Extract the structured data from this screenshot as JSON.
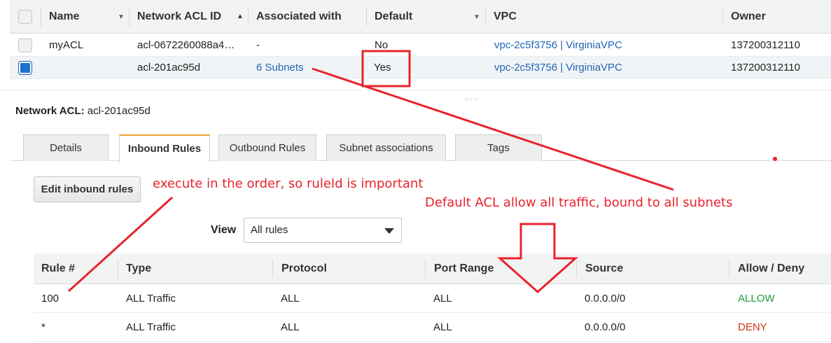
{
  "acl_table": {
    "columns": [
      "Name",
      "Network ACL ID",
      "Associated with",
      "Default",
      "VPC",
      "Owner"
    ],
    "rows": [
      {
        "name": "myACL",
        "id": "acl-0672260088a4…",
        "associated": "-",
        "default": "No",
        "vpc": "vpc-2c5f3756 | VirginiaVPC",
        "owner": "137200312110",
        "selected": false
      },
      {
        "name": "",
        "id": "acl-201ac95d",
        "associated": "6 Subnets",
        "default": "Yes",
        "vpc": "vpc-2c5f3756 | VirginiaVPC",
        "owner": "137200312110",
        "selected": true
      }
    ]
  },
  "detail": {
    "label": "Network ACL:",
    "value": "acl-201ac95d"
  },
  "tabs": [
    "Details",
    "Inbound Rules",
    "Outbound Rules",
    "Subnet associations",
    "Tags"
  ],
  "active_tab": "Inbound Rules",
  "edit_button": "Edit inbound rules",
  "view": {
    "label": "View",
    "selected": "All rules"
  },
  "rules_table": {
    "columns": [
      "Rule #",
      "Type",
      "Protocol",
      "Port Range",
      "Source",
      "Allow / Deny"
    ],
    "rows": [
      {
        "rule": "100",
        "type": "ALL Traffic",
        "protocol": "ALL",
        "port": "ALL",
        "source": "0.0.0.0/0",
        "action": "ALLOW"
      },
      {
        "rule": "*",
        "type": "ALL Traffic",
        "protocol": "ALL",
        "port": "ALL",
        "source": "0.0.0.0/0",
        "action": "DENY"
      }
    ]
  },
  "annotations": {
    "note_order": "execute in the order, so ruleId is important",
    "note_default": "Default ACL allow all traffic, bound to all subnets"
  },
  "colors": {
    "annotation": "#e8232b",
    "link": "#1f66b5",
    "allow": "#1e9e3a",
    "deny": "#d13212",
    "tab_accent": "#f0a32f"
  }
}
